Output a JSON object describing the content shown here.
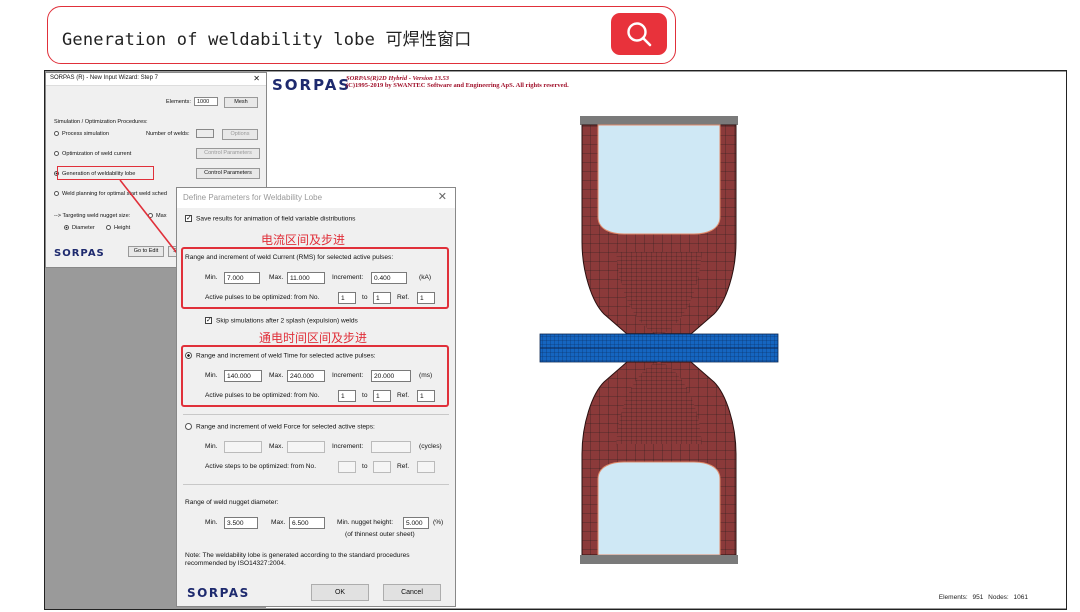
{
  "header": {
    "title": "Generation of weldability lobe 可焊性窗口"
  },
  "simulation": {
    "logo": "SORPAS",
    "version_line": "SORPAS(R)2D Hybrid - Version 13.53",
    "copyright_line": "(C)1995-2019 by SWANTEC Software and Engineering ApS. All rights reserved.",
    "stats": "Elements: 951 Nodes: 1061"
  },
  "wizard": {
    "title": "SORPAS (R) - New Input Wizard: Step 7",
    "elements_label": "Elements:",
    "elements_value": "1000",
    "mesh_button": "Mesh",
    "section_label": "Simulation / Optimization Procedures:",
    "process_simulation": "Process simulation",
    "number_of_welds": "Number of welds:",
    "options_button": "Options",
    "optimization_current": "Optimization of weld current",
    "control_parameters_button": "Control Parameters",
    "generation_lobe": "Generation of weldability lobe",
    "control_parameters_button2": "Control Parameters",
    "weld_planning": "Weld planning for optimal start weld sched",
    "targeting": "--> Targeting weld nugget size:",
    "max_label": "Max",
    "diameter": "Diameter",
    "height": "Height",
    "logo": "SORPAS",
    "goto_edit": "Go to Edit",
    "s_button": "S"
  },
  "dialog": {
    "title": "Define Parameters for Weldability Lobe",
    "save_results": "Save results for animation of field variable distributions",
    "annot_current": "电流区间及步进",
    "annot_time": "通电时间区间及步进",
    "current_section": "Range and increment of weld Current (RMS) for selected active pulses:",
    "current": {
      "min": "7.000",
      "max": "11.000",
      "increment": "0.400",
      "unit": "(kA)",
      "from": "1",
      "to": "1",
      "ref": "1"
    },
    "skip": "Skip simulations after 2 splash (expulsion) welds",
    "time_section": "Range and increment of weld Time for selected active pulses:",
    "time": {
      "min": "140.000",
      "max": "240.000",
      "increment": "20.000",
      "unit": "(ms)",
      "from": "1",
      "to": "1",
      "ref": "1"
    },
    "force_section": "Range and increment of weld Force for selected active steps:",
    "force_unit": "(cycles)",
    "labels": {
      "min": "Min.",
      "max": "Max.",
      "increment": "Increment:",
      "active_pulses": "Active pulses to be optimized:  from No.",
      "active_steps": "Active steps to be optimized:  from No.",
      "to": "to",
      "ref": "Ref."
    },
    "nugget_section": "Range of weld nugget diameter:",
    "nugget": {
      "min": "3.500",
      "max": "6.500",
      "height_label": "Min. nugget height:",
      "height": "5.000",
      "unit": "(%)",
      "note": "(of thinnest outer sheet)"
    },
    "note": "Note: The weldability lobe is generated according to the standard procedures recommended by ISO14327:2004.",
    "logo": "SORPAS",
    "ok": "OK",
    "cancel": "Cancel"
  },
  "colors": {
    "accent_red": "#e0303a",
    "electrode": "#8b3a3a",
    "coolant": "#cfe8f5",
    "sheet": "#1565c0",
    "logo_blue": "#1e2a6e"
  }
}
